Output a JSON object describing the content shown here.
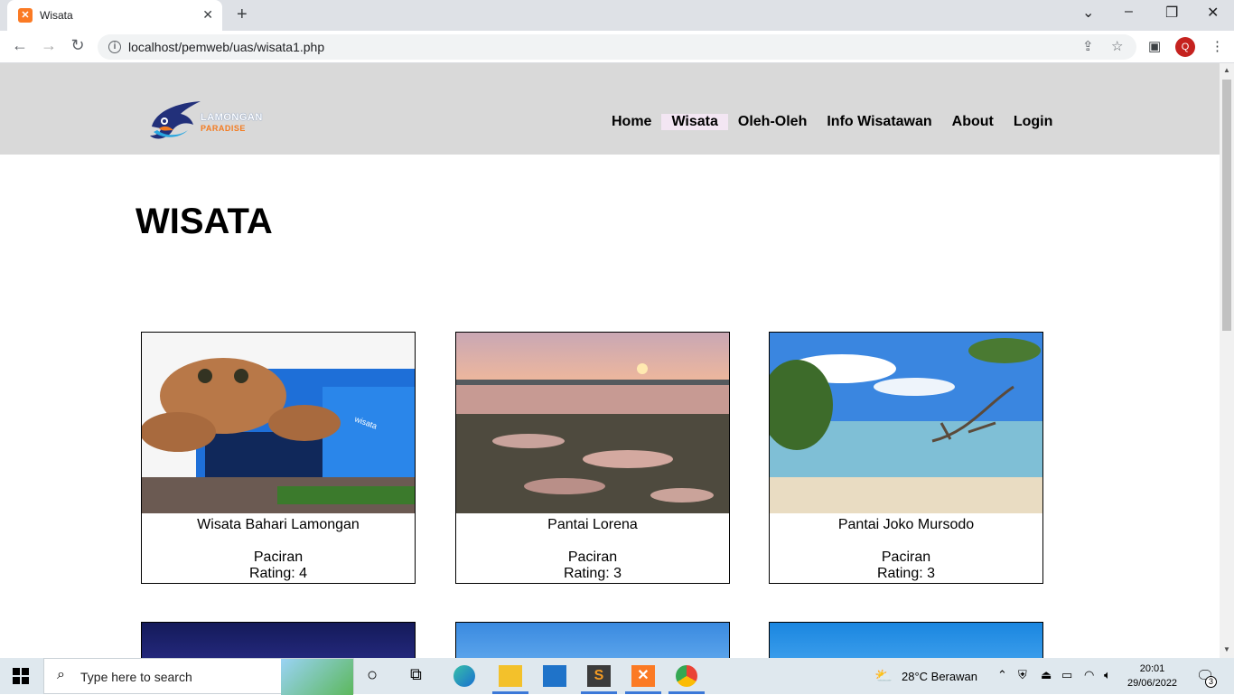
{
  "browser": {
    "tab_title": "Wisata",
    "url": "localhost/pemweb/uas/wisata1.php",
    "profile_initial": "Q"
  },
  "site": {
    "logo_line1": "LAMONGAN",
    "logo_line2": "PARADISE",
    "menu": [
      {
        "label": "Home",
        "active": false
      },
      {
        "label": "Wisata",
        "active": true
      },
      {
        "label": "Oleh-Oleh",
        "active": false
      },
      {
        "label": "Info Wisatawan",
        "active": false
      },
      {
        "label": "About",
        "active": false
      },
      {
        "label": "Login",
        "active": false
      }
    ],
    "page_title": "WISATA",
    "cards": [
      {
        "name": "Wisata Bahari Lamongan",
        "location": "Paciran",
        "rating": "Rating: 4"
      },
      {
        "name": "Pantai Lorena",
        "location": "Paciran",
        "rating": "Rating: 3"
      },
      {
        "name": "Pantai Joko Mursodo",
        "location": "Paciran",
        "rating": "Rating: 3"
      }
    ]
  },
  "taskbar": {
    "search_placeholder": "Type here to search",
    "weather": "28°C  Berawan",
    "time": "20:01",
    "date": "29/06/2022",
    "notification_count": "3"
  },
  "colors": {
    "header_bg": "#d9d9d9",
    "active_menu_bg": "#f3e6f3",
    "accent_blue": "#3b78d8"
  }
}
